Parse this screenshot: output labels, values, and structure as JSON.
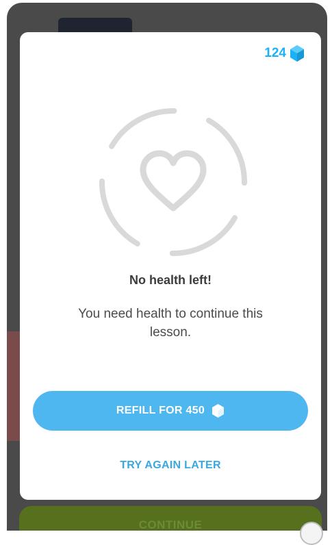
{
  "header": {
    "gem_count": "124",
    "gem_icon": "gem-icon"
  },
  "dialog": {
    "illustration_icon": "heart-icon",
    "title": "No health left!",
    "message": "You need health to continue this lesson.",
    "refill_label": "REFILL FOR 450",
    "refill_icon": "gem-icon",
    "try_again_label": "TRY AGAIN LATER"
  },
  "background": {
    "continue_label": "CONTINUE"
  },
  "colors": {
    "accent_blue": "#1cb0f6",
    "button_blue": "#4fb7f0",
    "continue_green": "#56701e",
    "heart_gray": "#d9d9d9"
  }
}
